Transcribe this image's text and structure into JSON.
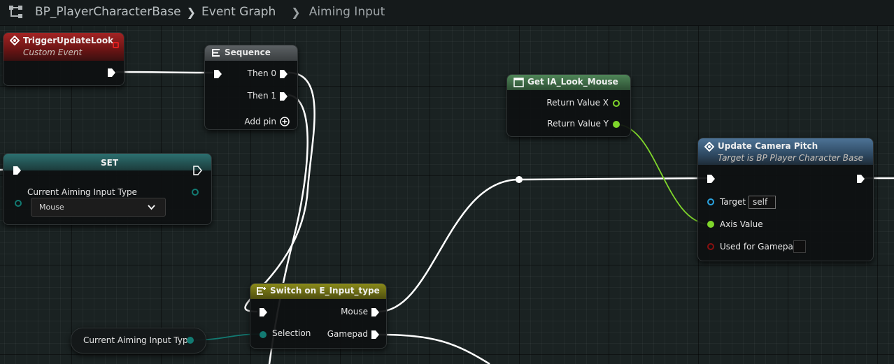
{
  "breadcrumb": {
    "blueprint": "BP_PlayerCharacterBase",
    "graph": "Event Graph",
    "subgraph": "Aiming Input"
  },
  "nodes": {
    "trigger_update_look": {
      "title": "TriggerUpdateLook",
      "subtitle": "Custom Event",
      "color": "#8f1d1d"
    },
    "sequence": {
      "title": "Sequence",
      "then0": "Then 0",
      "then1": "Then 1",
      "add_pin": "Add pin",
      "color": "#4a4f52"
    },
    "get_ia_look_mouse": {
      "title": "Get IA_Look_Mouse",
      "return_x": "Return Value X",
      "return_y": "Return Value Y",
      "color": "#3f6b47"
    },
    "update_camera_pitch": {
      "title": "Update Camera Pitch",
      "subtitle": "Target is BP Player Character Base",
      "target_label": "Target",
      "target_value": "self",
      "axis_label": "Axis Value",
      "gamepad_label": "Used for Gamepad",
      "color": "#3c5b7b"
    },
    "set_node": {
      "title": "SET",
      "var_label": "Current Aiming Input Type",
      "value": "Mouse",
      "color": "#2f6868"
    },
    "switch_node": {
      "title": "Switch on E_Input_type",
      "mouse": "Mouse",
      "selection": "Selection",
      "gamepad": "Gamepad",
      "color": "#6b6b12"
    },
    "var_getter": {
      "label": "Current Aiming Input Type"
    }
  },
  "colors": {
    "exec_wire": "#ffffff",
    "float_pin": "#7fd62b",
    "enum_pin": "#127a72",
    "object_pin": "#2aa3e0",
    "bool_pin": "#8a1010"
  }
}
